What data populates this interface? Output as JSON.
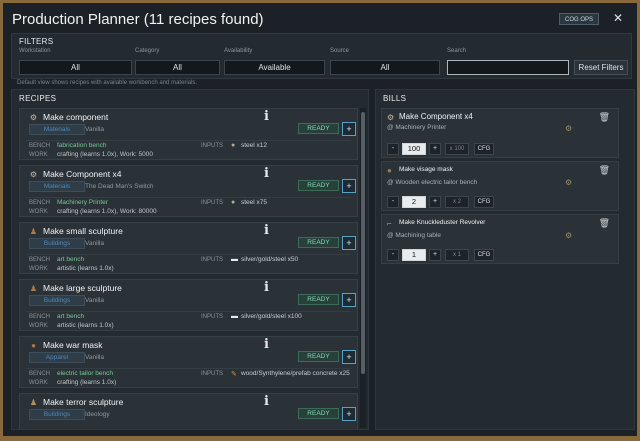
{
  "window": {
    "title": "Production Planner (11 recipes found)",
    "cog_ops_label": "COG OPS",
    "close_glyph": "✕"
  },
  "filters": {
    "section_title": "FILTERS",
    "workstation": {
      "label": "Workstation",
      "value": "All"
    },
    "category": {
      "label": "Category",
      "value": "All"
    },
    "availability": {
      "label": "Availability",
      "value": "Available"
    },
    "source": {
      "label": "Source",
      "value": "All"
    },
    "search": {
      "label": "Search",
      "value": ""
    },
    "reset_label": "Reset Filters",
    "hint": "Default view shows recipes with available workbench and materials."
  },
  "recipes": {
    "section_title": "RECIPES",
    "bench_key": "BENCH",
    "inputs_key": "INPUTS",
    "work_key": "WORK",
    "ready_label": "READY",
    "add_glyph": "+",
    "info_glyph": "i",
    "items": [
      {
        "title": "Make component",
        "icon": "component-icon",
        "category": "Materials",
        "source": "Vanilla",
        "bench": "fabrication bench",
        "inputs_icon": "steel-icon",
        "inputs": "steel x12",
        "work": "crafting (learns 1.0x), Work: 5000"
      },
      {
        "title": "Make Component x4",
        "icon": "component-icon",
        "category": "Materials",
        "source": "The Dead Man's Switch",
        "bench": "Machinery Printer",
        "inputs_icon": "steel-icon",
        "inputs": "steel x75",
        "work": "crafting (learns 1.0x), Work: 80000"
      },
      {
        "title": "Make small sculpture",
        "icon": "sculpture-icon",
        "category": "Buildings",
        "source": "Vanilla",
        "bench": "art bench",
        "inputs_icon": "silver-icon",
        "inputs": "silver/gold/steel x50",
        "work": "artistic (learns 1.0x)"
      },
      {
        "title": "Make large sculpture",
        "icon": "sculpture-icon",
        "category": "Buildings",
        "source": "Vanilla",
        "bench": "art bench",
        "inputs_icon": "silver-icon",
        "inputs": "silver/gold/steel x100",
        "work": "artistic (learns 1.0x)"
      },
      {
        "title": "Make war mask",
        "icon": "mask-icon",
        "category": "Apparel",
        "source": "Vanilla",
        "bench": "electric tailor bench",
        "inputs_icon": "wood-icon",
        "inputs": "wood/Synthylene/prefab concrete x25",
        "work": "crafting (learns 1.0x)"
      },
      {
        "title": "Make terror sculpture",
        "icon": "sculpture-icon",
        "category": "Buildings",
        "source": "Ideology",
        "bench": "",
        "inputs_icon": "",
        "inputs": "",
        "work": ""
      }
    ]
  },
  "bills": {
    "section_title": "BILLS",
    "minus_glyph": "-",
    "plus_glyph": "+",
    "cfg_label": "CFG",
    "items": [
      {
        "title": "Make Component x4",
        "icon": "component-icon",
        "bench": "@ Machinery Printer",
        "quantity": "100",
        "multiplier": "x 100"
      },
      {
        "title": "Make visage mask",
        "icon": "mask-icon",
        "bench": "@ Wooden electric tailor bench",
        "quantity": "2",
        "multiplier": "x 2"
      },
      {
        "title": "Make Knuckleduster Revolver",
        "icon": "revolver-icon",
        "bench": "@ Machining table",
        "quantity": "1",
        "multiplier": "x 1"
      }
    ]
  },
  "colors": {
    "frame": "#8a6a3c",
    "background": "#1b2126",
    "ready": "#7fdcb4",
    "bench_text": "#78c896",
    "category_text": "#4f87b8"
  }
}
